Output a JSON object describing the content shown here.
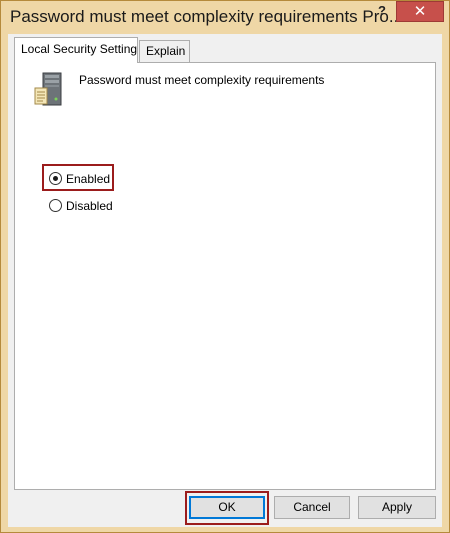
{
  "window": {
    "title": "Password must meet complexity requirements Pro...",
    "help_label": "?",
    "close_label": "✕"
  },
  "tabs": [
    {
      "label": "Local Security Setting",
      "active": true
    },
    {
      "label": "Explain",
      "active": false
    }
  ],
  "policy": {
    "icon": "server-icon",
    "name": "Password must meet complexity requirements"
  },
  "options": [
    {
      "label": "Enabled",
      "selected": true
    },
    {
      "label": "Disabled",
      "selected": false
    }
  ],
  "buttons": {
    "ok_label": "OK",
    "cancel_label": "Cancel",
    "apply_label": "Apply"
  },
  "colors": {
    "title_bar": "#efd7a6",
    "close_button": "#c7504b",
    "highlight": "#9b1c1c"
  }
}
